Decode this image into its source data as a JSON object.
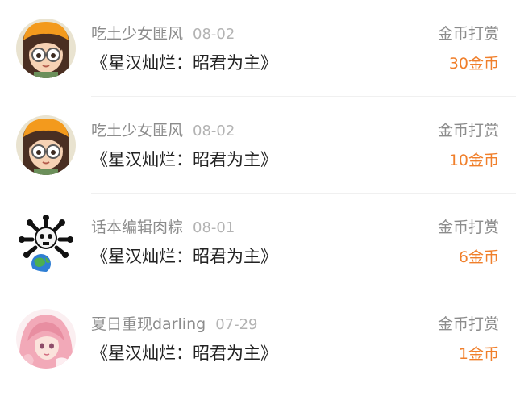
{
  "gift_records": [
    {
      "username": "吃土少女匪风",
      "date": "08-02",
      "book_title": "《星汉灿烂：昭君为主》",
      "gift_type": "金币打赏",
      "amount": "30金币",
      "avatar_icon": "cartoon-girl-glasses-avatar"
    },
    {
      "username": "吃土少女匪风",
      "date": "08-02",
      "book_title": "《星汉灿烂：昭君为主》",
      "gift_type": "金币打赏",
      "amount": "10金币",
      "avatar_icon": "cartoon-girl-glasses-avatar"
    },
    {
      "username": "话本编辑肉粽",
      "date": "08-01",
      "book_title": "《星汉灿烂：昭君为主》",
      "gift_type": "金币打赏",
      "amount": "6金币",
      "avatar_icon": "skull-earth-avatar"
    },
    {
      "username": "夏日重现darling",
      "date": "07-29",
      "book_title": "《星汉灿烂：昭君为主》",
      "gift_type": "金币打赏",
      "amount": "1金币",
      "avatar_icon": "anime-pink-hair-avatar"
    }
  ],
  "colors": {
    "amount": "#f07f2b",
    "secondary_text": "#8c8c8c",
    "primary_text": "#222222"
  }
}
